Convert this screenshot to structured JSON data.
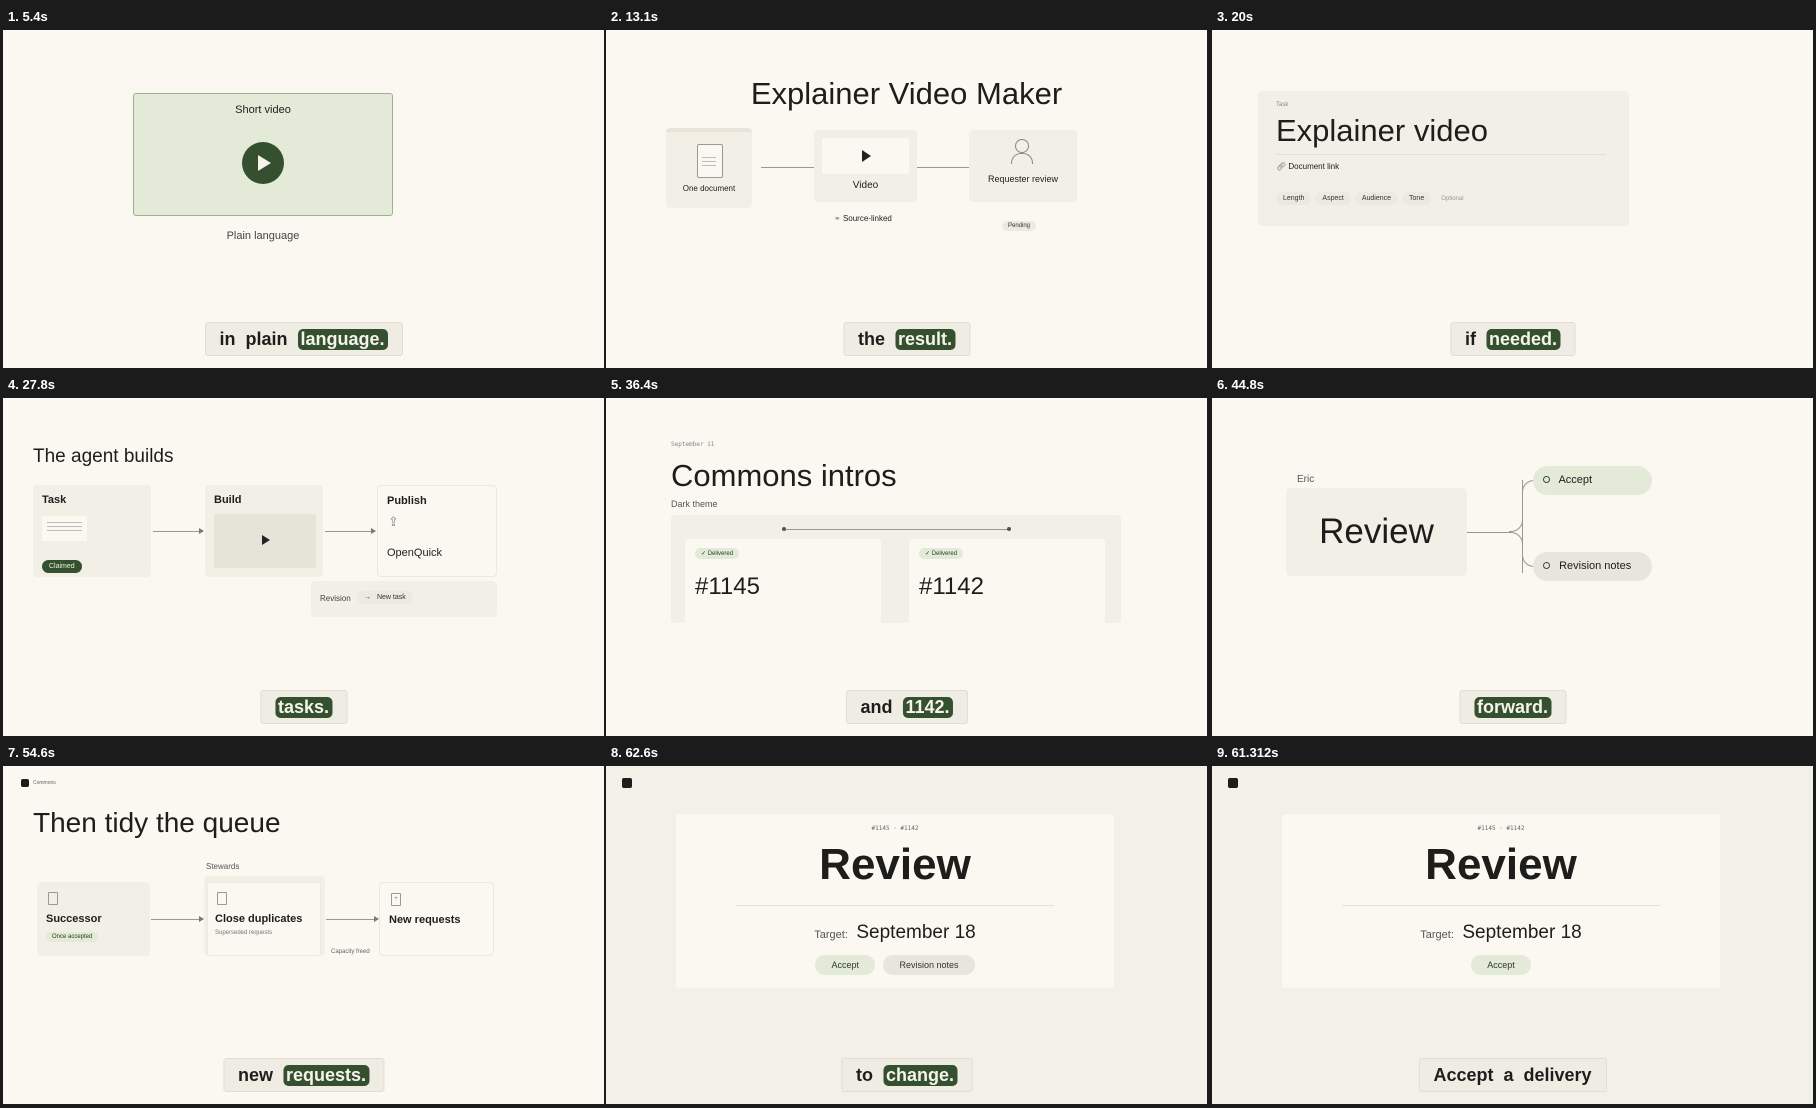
{
  "frames": [
    {
      "label": "1. 5.4s",
      "card_title": "Short video",
      "subtitle": "Plain language",
      "caption": [
        "in",
        "plain"
      ],
      "caption_hl": "language."
    },
    {
      "label": "2. 13.1s",
      "title": "Explainer Video Maker",
      "doc_label": "One document",
      "video_label": "Video",
      "review_label": "Requester review",
      "source_label": "Source-linked",
      "pending_label": "Pending",
      "caption": [
        "the"
      ],
      "caption_hl": "result."
    },
    {
      "label": "3. 20s",
      "task_label": "Task",
      "title": "Explainer video",
      "doc_link": "Document link",
      "chips": [
        "Length",
        "Aspect",
        "Audience",
        "Tone"
      ],
      "optional": "Optional",
      "caption": [
        "if"
      ],
      "caption_hl": "needed."
    },
    {
      "label": "4. 27.8s",
      "title": "The agent builds",
      "task": "Task",
      "claimed": "Claimed",
      "build": "Build",
      "publish": "Publish",
      "openquick": "OpenQuick",
      "revision": "Revision",
      "new_task": "New task",
      "caption": [],
      "caption_hl": "tasks."
    },
    {
      "label": "5. 36.4s",
      "date": "September 11",
      "title": "Commons intros",
      "theme": "Dark theme",
      "delivered": "Delivered",
      "ids": [
        "#1145",
        "#1142"
      ],
      "caption": [
        "and"
      ],
      "caption_hl": "1142."
    },
    {
      "label": "6. 44.8s",
      "name": "Eric",
      "review": "Review",
      "accept": "Accept",
      "revision_notes": "Revision notes",
      "caption": [],
      "caption_hl": "forward."
    },
    {
      "label": "7. 54.6s",
      "brand": "Commons",
      "title": "Then tidy the queue",
      "stewards": "Stewards",
      "successor": "Successor",
      "once_accepted": "Once accepted",
      "close_dup": "Close duplicates",
      "superseded": "Superseded requests",
      "new_requests": "New requests",
      "capacity": "Capacity freed",
      "caption": [
        "new"
      ],
      "caption_hl": "requests."
    },
    {
      "label": "8. 62.6s",
      "ids": "#1145 · #1142",
      "title": "Review",
      "target_label": "Target:",
      "target_date": "September 18",
      "accept": "Accept",
      "revision_notes": "Revision notes",
      "caption": [
        "to"
      ],
      "caption_hl": "change."
    },
    {
      "label": "9. 61.312s",
      "ids": "#1145 · #1142",
      "title": "Review",
      "target_label": "Target:",
      "target_date": "September 18",
      "accept": "Accept",
      "caption": [
        "Accept",
        "a",
        "delivery"
      ]
    }
  ],
  "colors": {
    "accent": "#34502f",
    "bg": "#faf8f1",
    "panel": "#f2efe7",
    "green_soft": "#e3ead8"
  }
}
